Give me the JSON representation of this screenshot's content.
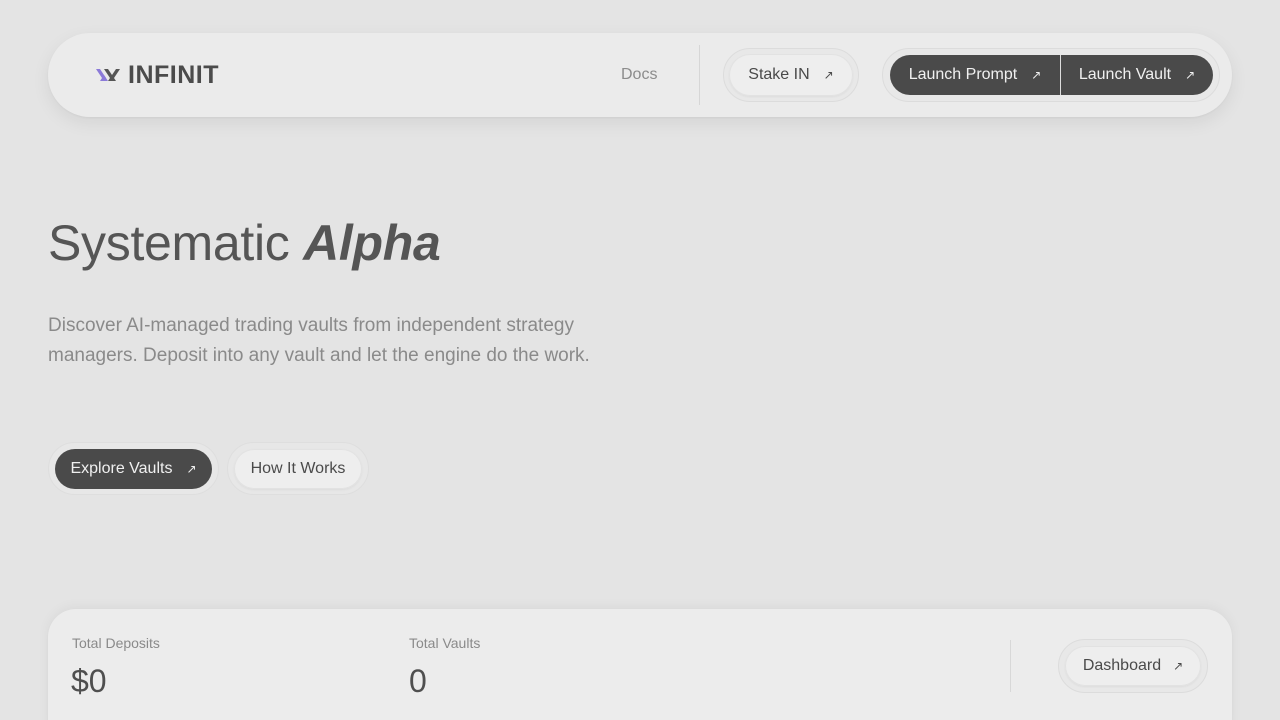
{
  "header": {
    "brand": "INFINIT",
    "docs_label": "Docs",
    "stake_label": "Stake IN",
    "launch_prompt_label": "Launch Prompt",
    "launch_vault_label": "Launch Vault"
  },
  "hero": {
    "title_plain": "Systematic ",
    "title_emphasis": "Alpha",
    "description": "Discover AI-managed trading vaults from independent strategy managers. Deposit into any vault and let the engine do the work.",
    "explore_label": "Explore Vaults",
    "how_label": "How It Works"
  },
  "stats": {
    "total_deposits_label": "Total Deposits",
    "total_deposits_value": "$0",
    "total_vaults_label": "Total Vaults",
    "total_vaults_value": "0",
    "dashboard_label": "Dashboard"
  },
  "icons": {
    "external": "arrow-up-right-icon",
    "logo": "infinit-logo-icon"
  },
  "colors": {
    "background": "#e4e4e4",
    "dark_button": "#4a4a4a",
    "logo_accent": "#8b7ad8"
  }
}
